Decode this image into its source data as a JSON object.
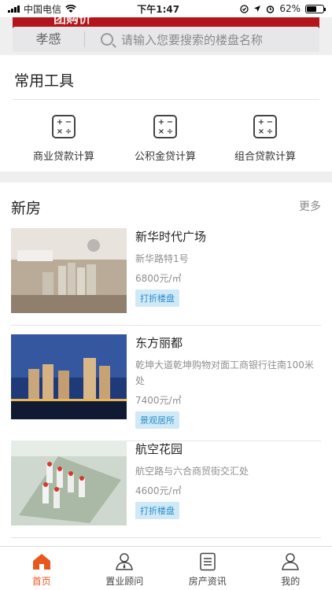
{
  "status": {
    "carrier": "中国电信",
    "time": "下午1:47",
    "battery": "62%",
    "battery_level": 0.62
  },
  "banner": {
    "text": "团购价"
  },
  "search": {
    "city": "孝感",
    "placeholder": "请输入您要搜索的楼盘名称"
  },
  "tools": {
    "title": "常用工具",
    "items": [
      {
        "label": "商业贷款计算",
        "icon": "calculator-icon"
      },
      {
        "label": "公积金贷计算",
        "icon": "calculator-icon"
      },
      {
        "label": "组合贷款计算",
        "icon": "calculator-icon"
      }
    ]
  },
  "new_houses": {
    "title": "新房",
    "more": "更多",
    "listings": [
      {
        "name": "新华时代广场",
        "address": "新华路特1号",
        "price": "6800元/㎡",
        "tag": "打折楼盘"
      },
      {
        "name": "东方丽都",
        "address": "乾坤大道乾坤购物对面工商银行往南100米处",
        "price": "7400元/㎡",
        "tag": "景观居所"
      },
      {
        "name": "航空花园",
        "address": "航空路与六合商贸街交汇处",
        "price": "4600元/㎡",
        "tag": "打折楼盘"
      }
    ]
  },
  "tabbar": {
    "items": [
      {
        "label": "首页",
        "icon": "home-icon",
        "active": true
      },
      {
        "label": "置业顾问",
        "icon": "advisor-icon",
        "active": false
      },
      {
        "label": "房产资讯",
        "icon": "news-icon",
        "active": false
      },
      {
        "label": "我的",
        "icon": "profile-icon",
        "active": false
      }
    ]
  },
  "colors": {
    "accent": "#e8571e",
    "banner_red": "#b4151a",
    "tag_bg": "#cfe9f7",
    "tag_text": "#2a8ec9"
  }
}
